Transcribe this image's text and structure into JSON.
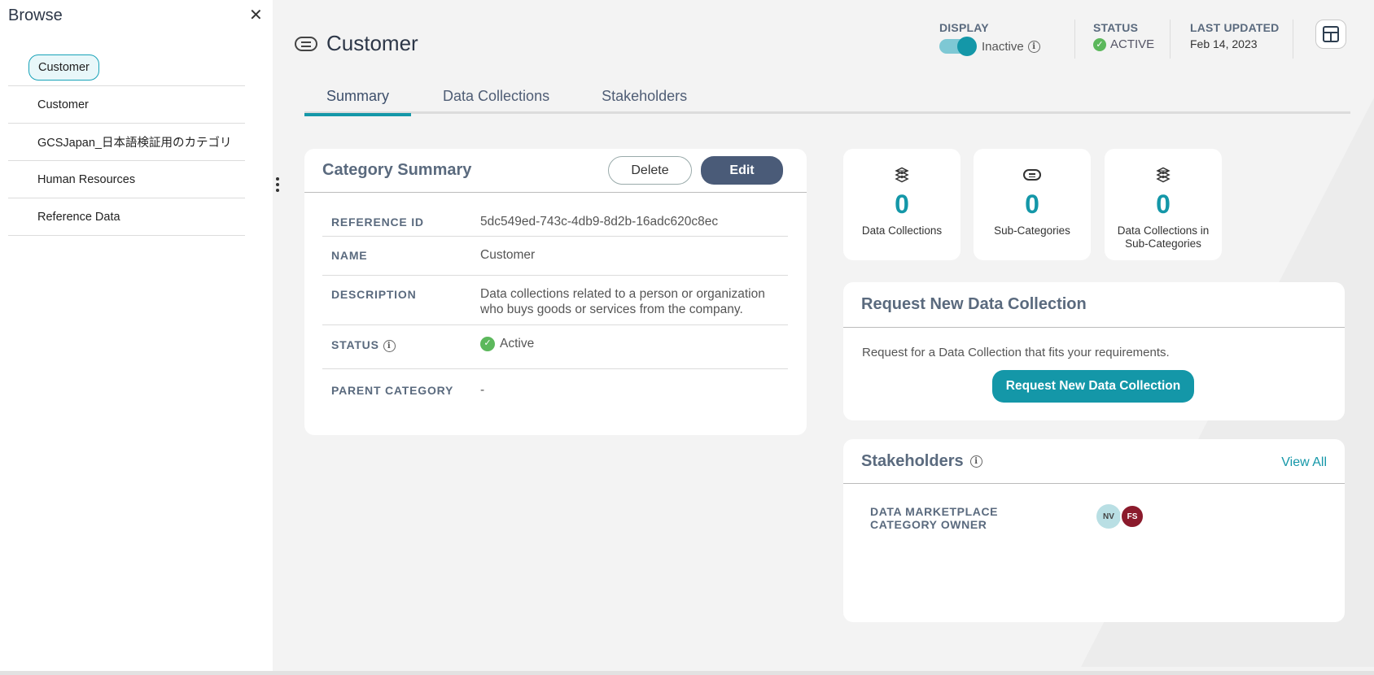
{
  "sidebar": {
    "title": "Browse",
    "items": [
      {
        "label": "Customer"
      },
      {
        "label": "Customer"
      },
      {
        "label": "GCSJapan_日本語検証用のカテゴリ"
      },
      {
        "label": "Human Resources"
      },
      {
        "label": "Reference Data"
      }
    ]
  },
  "header": {
    "title": "Customer",
    "display_label": "DISPLAY",
    "display_state": "Inactive",
    "status_label": "STATUS",
    "status_value": "ACTIVE",
    "updated_label": "LAST UPDATED",
    "updated_value": "Feb 14, 2023"
  },
  "tabs": [
    {
      "label": "Summary",
      "active": true
    },
    {
      "label": "Data Collections",
      "active": false
    },
    {
      "label": "Stakeholders",
      "active": false
    }
  ],
  "summary": {
    "title": "Category Summary",
    "delete_label": "Delete",
    "edit_label": "Edit",
    "rows": [
      {
        "label": "REFERENCE ID",
        "value": "5dc549ed-743c-4db9-8d2b-16adc620c8ec"
      },
      {
        "label": "NAME",
        "value": "Customer"
      },
      {
        "label": "DESCRIPTION",
        "value": "Data collections related to a person or organization who buys goods or services from the company."
      },
      {
        "label": "STATUS",
        "value": "Active"
      },
      {
        "label": "PARENT CATEGORY",
        "value": "-"
      }
    ]
  },
  "stats": [
    {
      "value": "0",
      "label": "Data Collections",
      "icon": "layers-icon"
    },
    {
      "value": "0",
      "label": "Sub-Categories",
      "icon": "category-icon"
    },
    {
      "value": "0",
      "label": "Data Collections in Sub-Categories",
      "icon": "layers-icon"
    }
  ],
  "request": {
    "title": "Request New Data Collection",
    "text": "Request for a Data Collection that fits your requirements.",
    "button_label": "Request New Data Collection"
  },
  "stakeholders": {
    "title": "Stakeholders",
    "view_all": "View All",
    "role": "DATA MARKETPLACE CATEGORY OWNER",
    "avatars": [
      "NV",
      "FS"
    ]
  },
  "colors": {
    "accent": "#1497a8",
    "edit_button": "#4a5b78",
    "status_green": "#5cb85c",
    "avatar_fs": "#8b1a2c",
    "avatar_nv": "#b9dfe4"
  }
}
